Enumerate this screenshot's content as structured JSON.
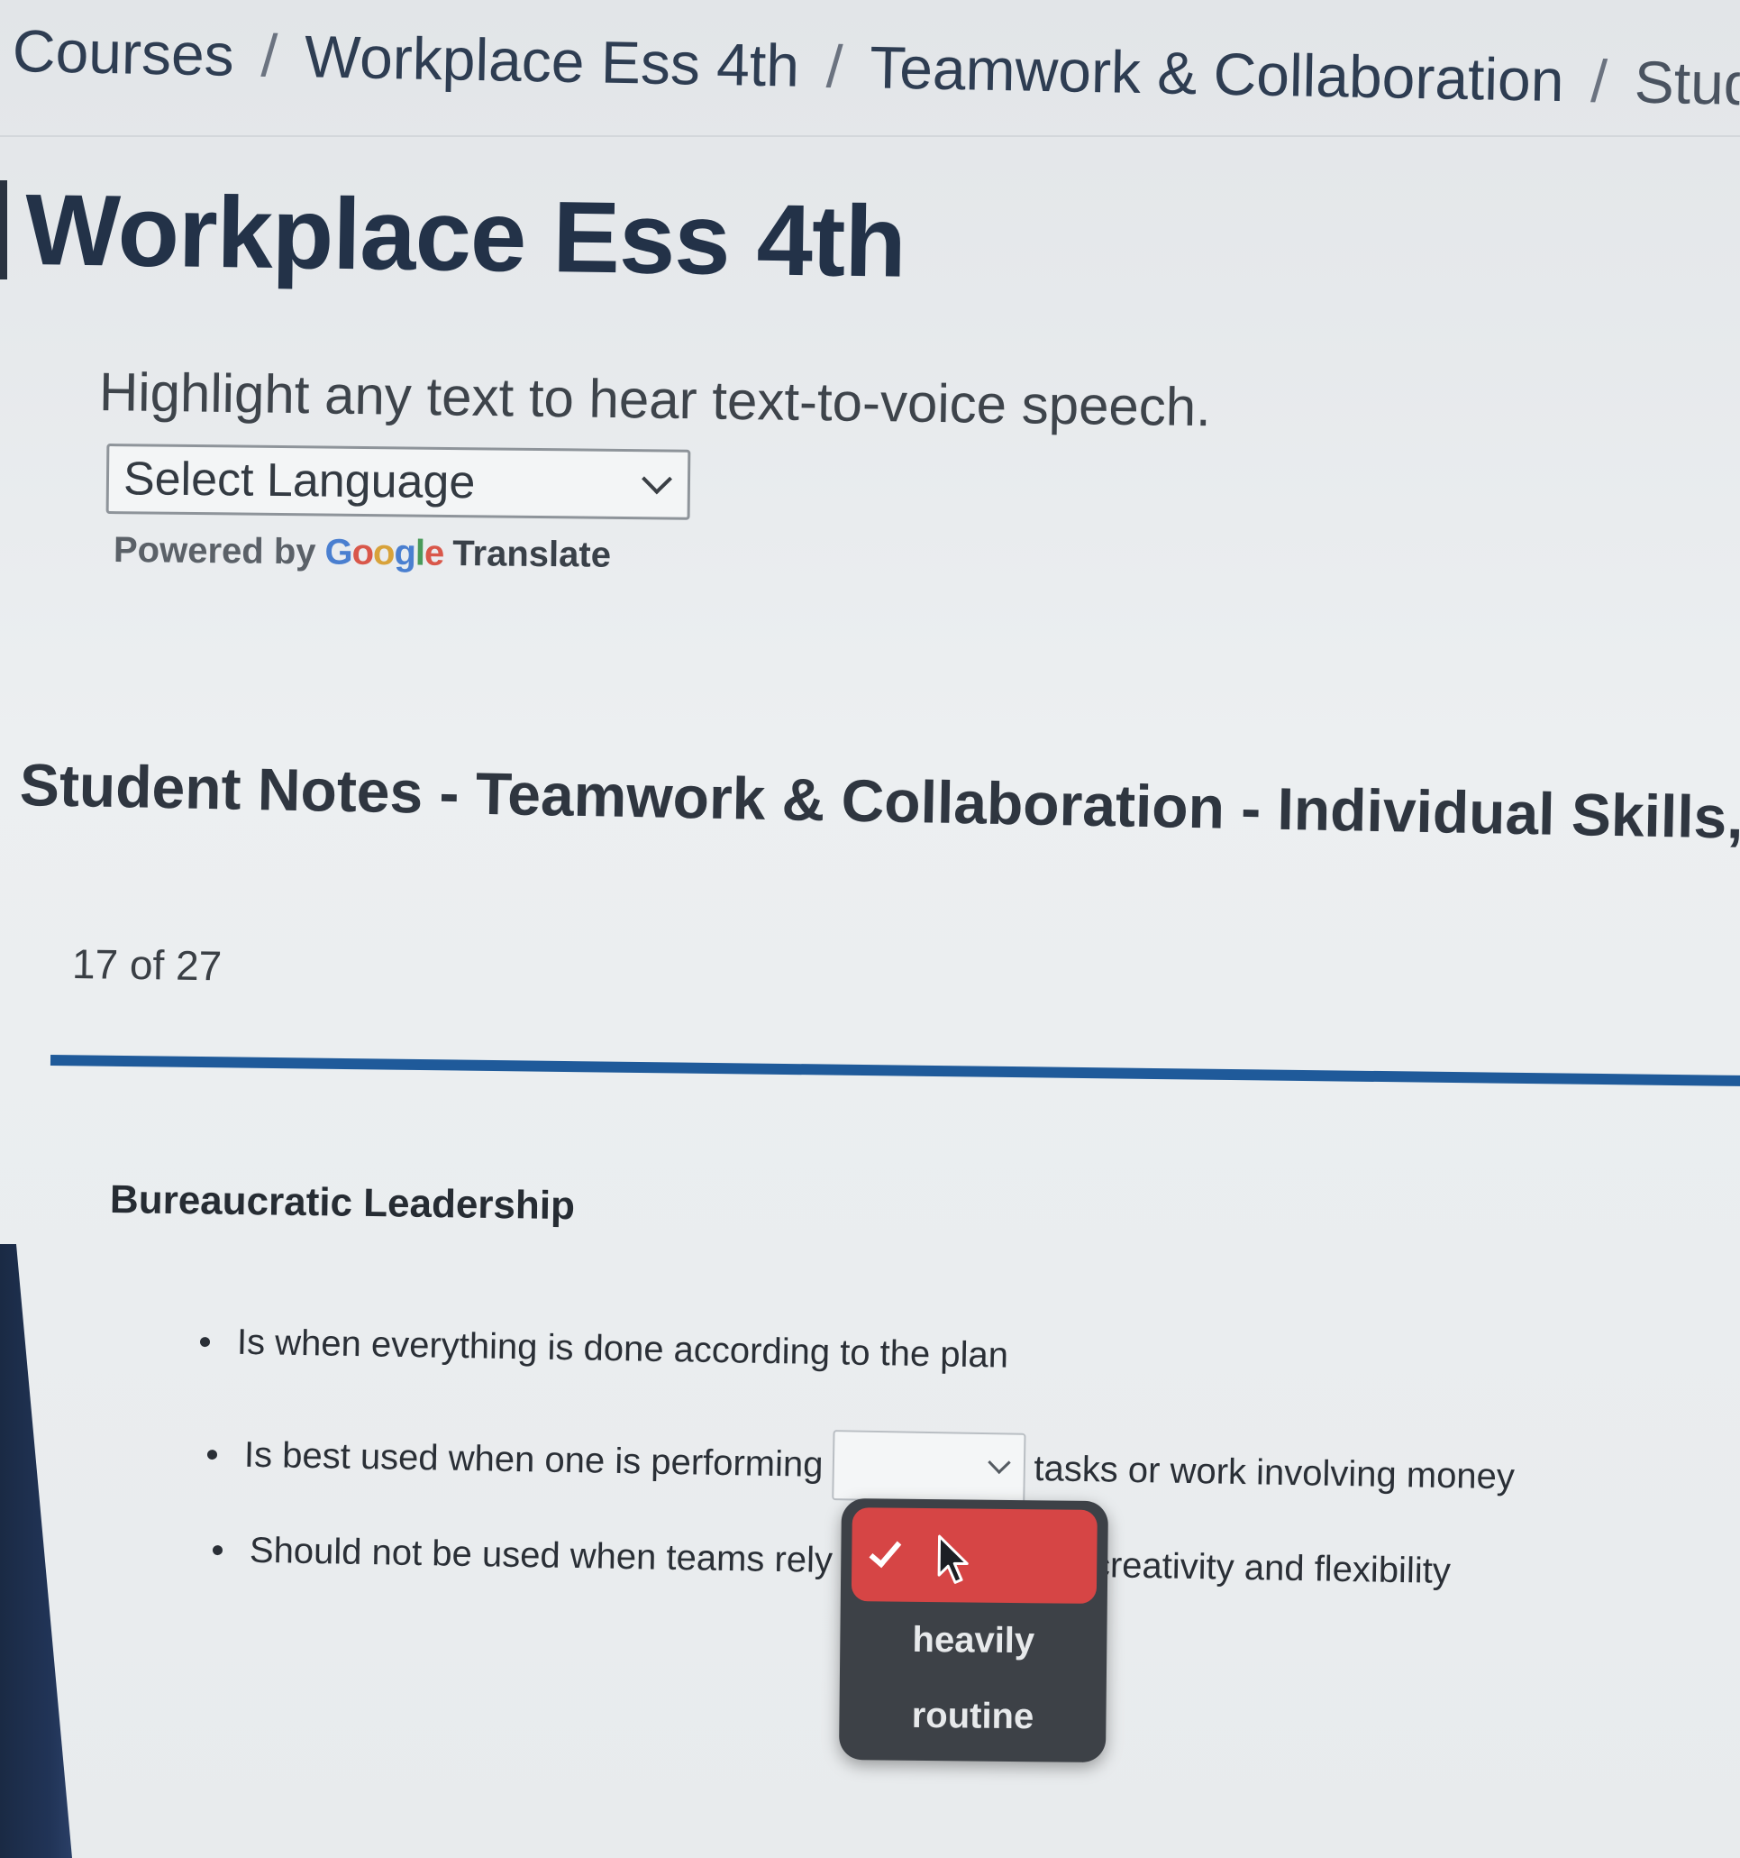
{
  "breadcrumb": {
    "items": [
      "Courses",
      "Workplace Ess 4th",
      "Teamwork & Collaboration",
      "Student Not"
    ],
    "separator": "/"
  },
  "course_title": "Workplace Ess 4th",
  "tts_hint": "Highlight any text to hear text-to-voice speech.",
  "language_select": {
    "value": "Select Language",
    "powered_by": "Powered by",
    "google": [
      "G",
      "o",
      "o",
      "g",
      "l",
      "e"
    ],
    "translate": "Translate"
  },
  "notes_heading": "Student Notes - Teamwork & Collaboration - Individual Skills, Style & F",
  "page_counter": "17 of 27",
  "section_title": "Bureaucratic Leadership",
  "bullets": {
    "b1": "Is when everything is done according to the plan",
    "b2_before": "Is best used when one is performing",
    "b2_after": "tasks or work involving money",
    "b3_before": "Should not be used when teams rely",
    "b3_after": "creativity and flexibility"
  },
  "dropdown": {
    "options": [
      "heavily",
      "routine"
    ]
  },
  "colors": {
    "accent_blue": "#1f5a9a",
    "selected_option": "#d64545",
    "popup_bg": "#3d4147"
  },
  "icons": {
    "select_chevron": "chevron-down-icon",
    "selected_mark": "checkmark-icon",
    "pointer": "mouse-cursor-icon"
  }
}
